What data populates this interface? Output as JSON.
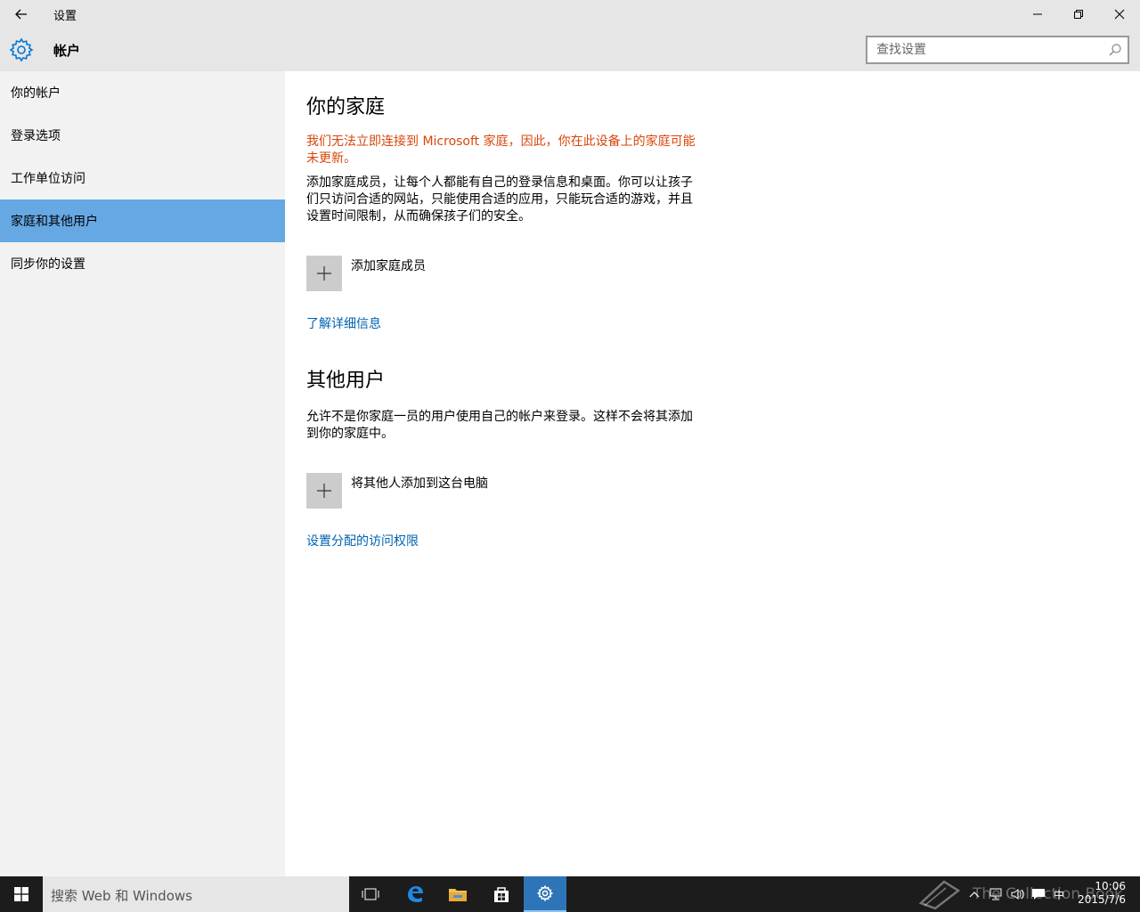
{
  "window": {
    "title": "设置"
  },
  "header": {
    "section_title": "帐户",
    "search_placeholder": "查找设置"
  },
  "sidebar": {
    "items": [
      {
        "label": "你的帐户",
        "active": false
      },
      {
        "label": "登录选项",
        "active": false
      },
      {
        "label": "工作单位访问",
        "active": false
      },
      {
        "label": "家庭和其他用户",
        "active": true
      },
      {
        "label": "同步你的设置",
        "active": false
      }
    ]
  },
  "family": {
    "heading": "你的家庭",
    "warning": "我们无法立即连接到 Microsoft 家庭，因此，你在此设备上的家庭可能未更新。",
    "description": "添加家庭成员，让每个人都能有自己的登录信息和桌面。你可以让孩子们只访问合适的网站，只能使用合适的应用，只能玩合适的游戏，并且设置时间限制，从而确保孩子们的安全。",
    "add_label": "添加家庭成员",
    "learn_more": "了解详细信息"
  },
  "others": {
    "heading": "其他用户",
    "description": "允许不是你家庭一员的用户使用自己的帐户来登录。这样不会将其添加到你的家庭中。",
    "add_label": "将其他人添加到这台电脑",
    "assigned_access": "设置分配的访问权限"
  },
  "taskbar": {
    "search_text": "搜索 Web 和 Windows",
    "ime": "中",
    "time": "10:06",
    "date": "2015/7/6",
    "watermark": "The Collection Book"
  },
  "colors": {
    "accent": "#0078d7",
    "nav_active": "#65a8e3",
    "warning": "#d9460b",
    "link": "#0063b1"
  }
}
